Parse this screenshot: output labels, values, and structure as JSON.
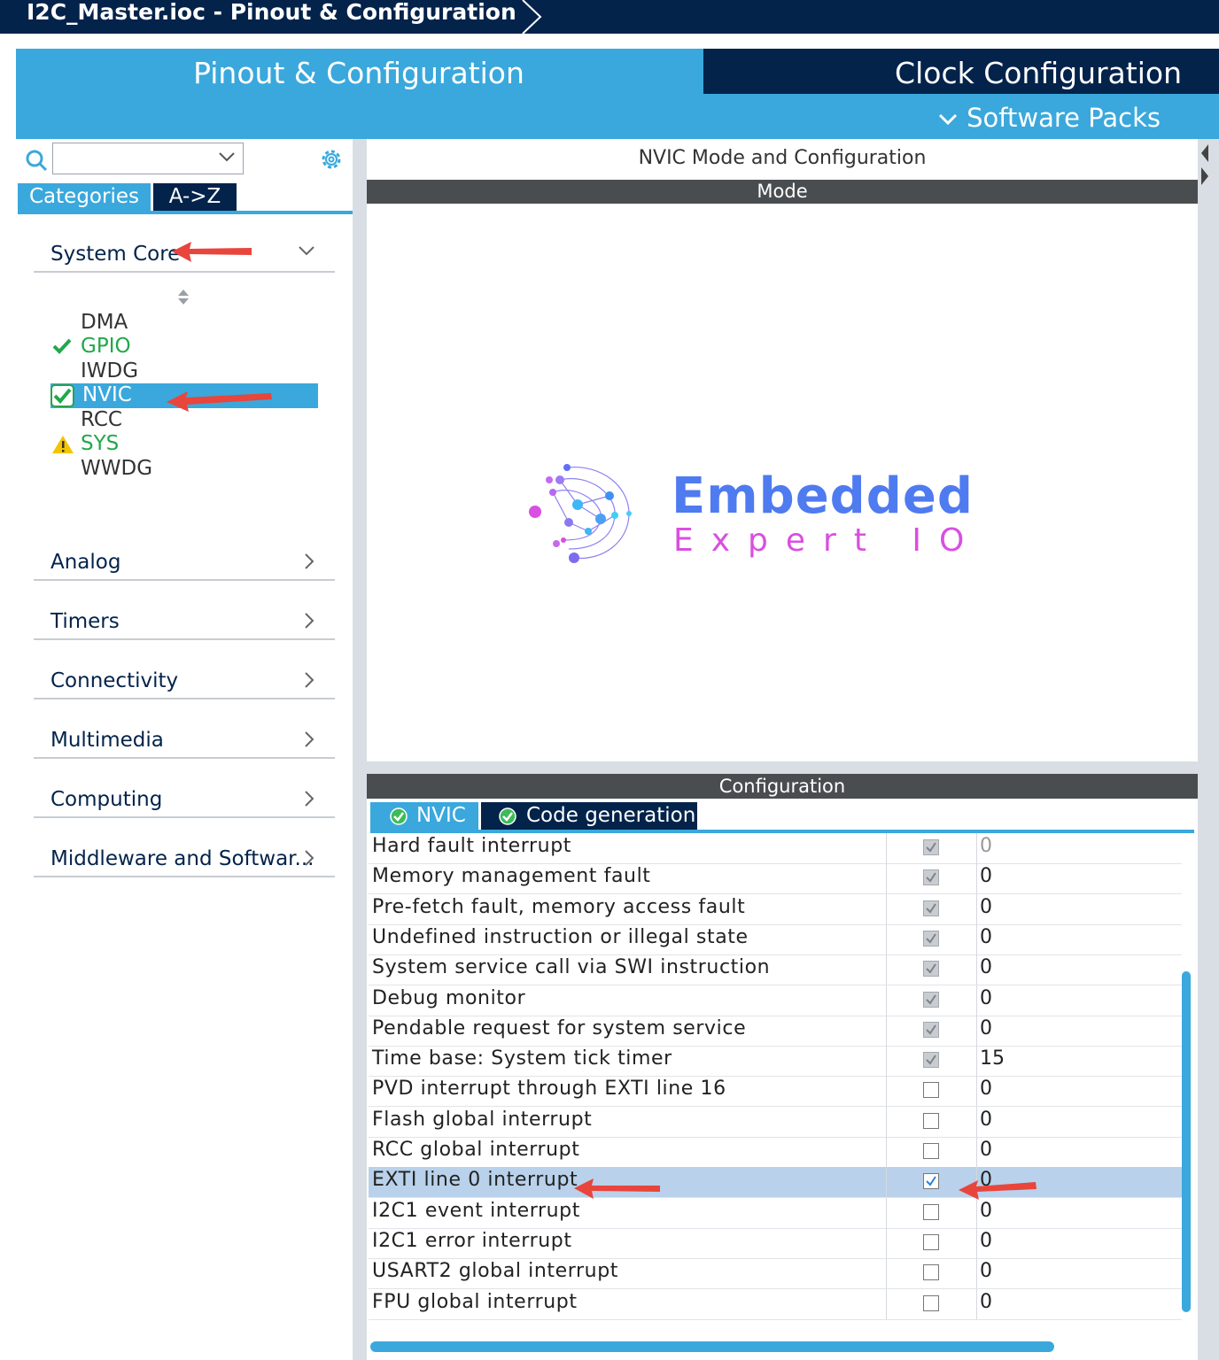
{
  "window": {
    "breadcrumb": "I2C_Master.ioc - Pinout & Configuration"
  },
  "top_tabs": {
    "pinout": "Pinout & Configuration",
    "clock": "Clock Configuration",
    "software_packs": "Software Packs"
  },
  "sidebar": {
    "search": {
      "value": "",
      "placeholder": ""
    },
    "view_tabs": {
      "categories": "Categories",
      "az": "A->Z"
    },
    "expanded_group": "System Core",
    "system_core_items": [
      {
        "label": "DMA",
        "status": "none"
      },
      {
        "label": "GPIO",
        "status": "ok"
      },
      {
        "label": "IWDG",
        "status": "none"
      },
      {
        "label": "NVIC",
        "status": "ok-selected"
      },
      {
        "label": "RCC",
        "status": "none"
      },
      {
        "label": "SYS",
        "status": "warning"
      },
      {
        "label": "WWDG",
        "status": "none"
      }
    ],
    "groups": [
      "Analog",
      "Timers",
      "Connectivity",
      "Multimedia",
      "Computing",
      "Middleware and Softwar..."
    ]
  },
  "main": {
    "title": "NVIC Mode and Configuration",
    "mode_label": "Mode",
    "config_label": "Configuration",
    "config_tabs": {
      "nvic": "NVIC",
      "codegen": "Code generation"
    },
    "logo": {
      "line1": "Embedded",
      "line2": "Expert IO"
    },
    "interrupts": [
      {
        "name": "Hard fault interrupt",
        "enabled": true,
        "locked": true,
        "priority": "0"
      },
      {
        "name": "Memory management fault",
        "enabled": true,
        "locked": true,
        "priority": "0"
      },
      {
        "name": "Pre-fetch fault, memory access fault",
        "enabled": true,
        "locked": true,
        "priority": "0"
      },
      {
        "name": "Undefined instruction or illegal state",
        "enabled": true,
        "locked": true,
        "priority": "0"
      },
      {
        "name": "System service call via SWI instruction",
        "enabled": true,
        "locked": true,
        "priority": "0"
      },
      {
        "name": "Debug monitor",
        "enabled": true,
        "locked": true,
        "priority": "0"
      },
      {
        "name": "Pendable request for system service",
        "enabled": true,
        "locked": true,
        "priority": "0"
      },
      {
        "name": "Time base: System tick timer",
        "enabled": true,
        "locked": true,
        "priority": "15"
      },
      {
        "name": "PVD interrupt through EXTI line 16",
        "enabled": false,
        "locked": false,
        "priority": "0"
      },
      {
        "name": "Flash global interrupt",
        "enabled": false,
        "locked": false,
        "priority": "0"
      },
      {
        "name": "RCC global interrupt",
        "enabled": false,
        "locked": false,
        "priority": "0"
      },
      {
        "name": "EXTI line 0 interrupt",
        "enabled": true,
        "locked": false,
        "priority": "0",
        "selected": true
      },
      {
        "name": "I2C1 event interrupt",
        "enabled": false,
        "locked": false,
        "priority": "0"
      },
      {
        "name": "I2C1 error interrupt",
        "enabled": false,
        "locked": false,
        "priority": "0"
      },
      {
        "name": "USART2 global interrupt",
        "enabled": false,
        "locked": false,
        "priority": "0"
      },
      {
        "name": "FPU global interrupt",
        "enabled": false,
        "locked": false,
        "priority": "0"
      }
    ]
  },
  "colors": {
    "navy": "#03234b",
    "accent": "#3aa8dc",
    "ok_green": "#21a84a",
    "warn_yellow": "#f5c400",
    "annotation_red": "#e8453c"
  }
}
